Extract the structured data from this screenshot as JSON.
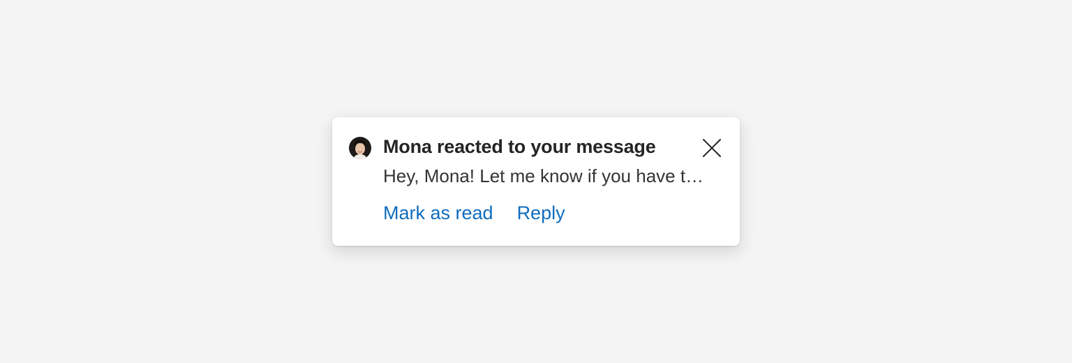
{
  "notification": {
    "title": "Mona reacted to your message",
    "message": "Hey, Mona! Let me know if you have t…",
    "avatar": "avatar-photo",
    "close_icon": "close-icon",
    "actions": {
      "mark_as_read": "Mark as read",
      "reply": "Reply"
    },
    "colors": {
      "background": "#f4f4f4",
      "card": "#ffffff",
      "link": "#0f6cbd",
      "title": "#242424"
    }
  }
}
